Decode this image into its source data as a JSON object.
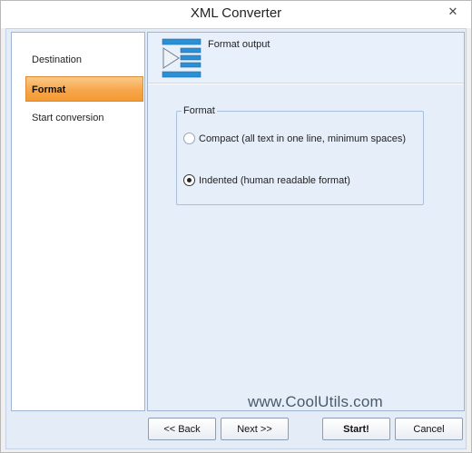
{
  "window": {
    "title": "XML Converter",
    "close_glyph": "✕"
  },
  "sidebar": {
    "items": [
      {
        "label": "Destination",
        "active": false
      },
      {
        "label": "Format",
        "active": true
      },
      {
        "label": "Start conversion",
        "active": false
      }
    ]
  },
  "banner": {
    "title": "Format output",
    "icon": "format-output-icon"
  },
  "format_group": {
    "legend": "Format",
    "options": [
      {
        "label": "Compact (all text in one line, minimum spaces)",
        "checked": false
      },
      {
        "label": "Indented (human readable format)",
        "checked": true
      }
    ]
  },
  "watermark": "www.CoolUtils.com",
  "buttons": {
    "back": "<< Back",
    "next": "Next >>",
    "start": "Start!",
    "cancel": "Cancel"
  },
  "colors": {
    "active_tab": "#f7a64a",
    "panel_bg": "#e6eef9",
    "icon_blue": "#2b8fd6"
  }
}
